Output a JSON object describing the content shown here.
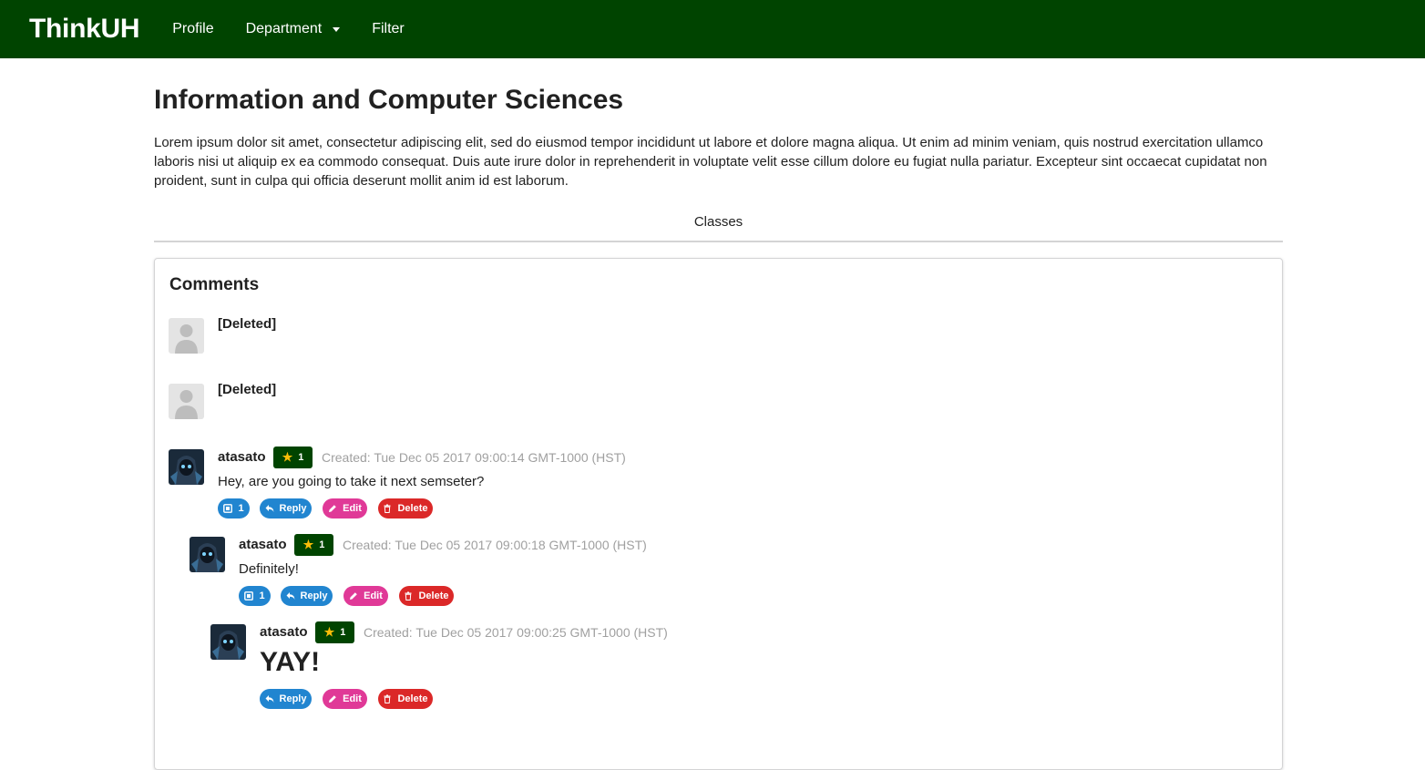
{
  "nav": {
    "brand": "ThinkUH",
    "profile": "Profile",
    "department": "Department",
    "filter": "Filter"
  },
  "page": {
    "title": "Information and Computer Sciences",
    "description": "Lorem ipsum dolor sit amet, consectetur adipiscing elit, sed do eiusmod tempor incididunt ut labore et dolore magna aliqua. Ut enim ad minim veniam, quis nostrud exercitation ullamco laboris nisi ut aliquip ex ea commodo consequat. Duis aute irure dolor in reprehenderit in voluptate velit esse cillum dolore eu fugiat nulla pariatur. Excepteur sint occaecat cupidatat non proident, sunt in culpa qui officia deserunt mollit anim id est laborum.",
    "tab": "Classes"
  },
  "comments": {
    "title": "Comments",
    "items": [
      {
        "author": "[Deleted]"
      },
      {
        "author": "[Deleted]"
      },
      {
        "author": "atasato",
        "stars": "1",
        "created": "Created: Tue Dec 05 2017 09:00:14 GMT-1000 (HST)",
        "text": "Hey, are you going to take it next semseter?",
        "replies_count": "1",
        "reply_label": "Reply",
        "edit_label": "Edit",
        "delete_label": "Delete"
      },
      {
        "author": "atasato",
        "stars": "1",
        "created": "Created: Tue Dec 05 2017 09:00:18 GMT-1000 (HST)",
        "text": "Definitely!",
        "replies_count": "1",
        "reply_label": "Reply",
        "edit_label": "Edit",
        "delete_label": "Delete"
      },
      {
        "author": "atasato",
        "stars": "1",
        "created": "Created: Tue Dec 05 2017 09:00:25 GMT-1000 (HST)",
        "text": "YAY!",
        "reply_label": "Reply",
        "edit_label": "Edit",
        "delete_label": "Delete"
      }
    ]
  },
  "colors": {
    "navbar": "#004400",
    "badge": "#004400",
    "star": "#fbbd08",
    "reply": "#2185d0",
    "edit": "#e03997",
    "delete": "#db2828"
  }
}
